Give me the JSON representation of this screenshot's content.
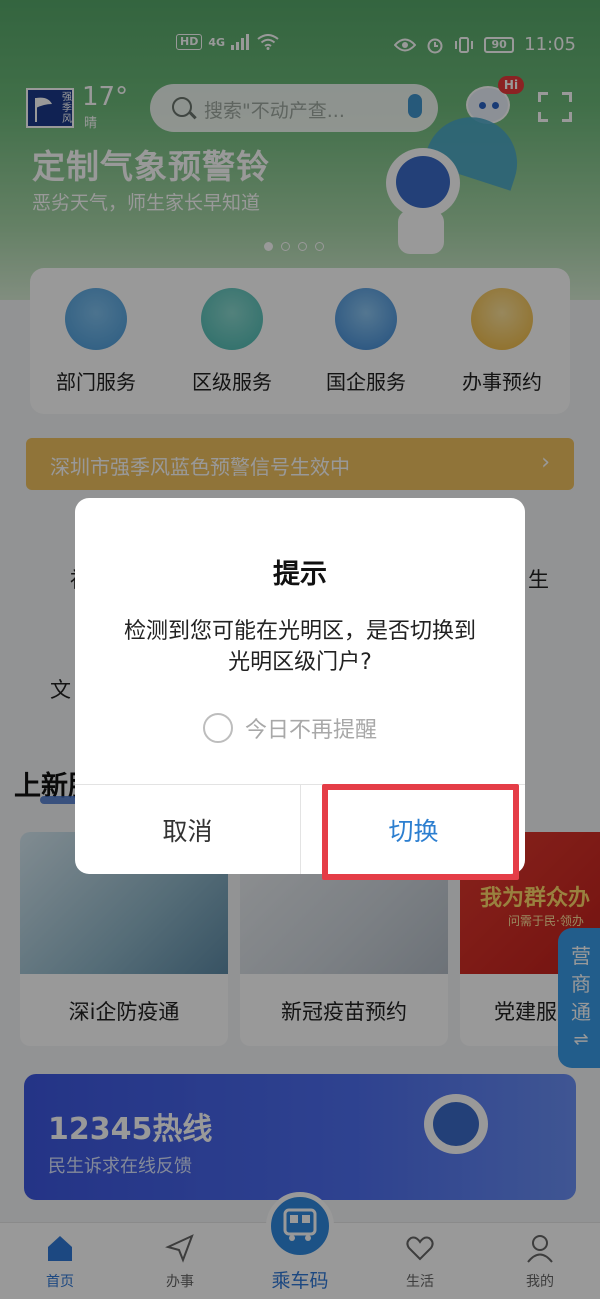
{
  "status_bar": {
    "network_badge": "HD",
    "network_type": "4G",
    "battery": "90",
    "time": "11:05"
  },
  "header": {
    "logo_text": "强季风",
    "temperature": "17°",
    "weather": "晴",
    "search_placeholder": "搜索\"不动产查...",
    "assistant_badge": "Hi"
  },
  "banner": {
    "title": "定制气象预警铃",
    "subtitle": "恶劣天气，师生家长早知道",
    "page_count": 4,
    "active_index": 0
  },
  "services": [
    {
      "label": "部门服务",
      "icon": "department-icon",
      "color": "#4a9ad8"
    },
    {
      "label": "区级服务",
      "icon": "district-icon",
      "color": "#49b8b0"
    },
    {
      "label": "国企服务",
      "icon": "enterprise-icon",
      "color": "#3c86d3"
    },
    {
      "label": "办事预约",
      "icon": "appointment-icon",
      "color": "#f0b63a"
    }
  ],
  "notice": {
    "text": "深圳市强季风蓝色预警信号生效中",
    "arrow": "›"
  },
  "partial_labels": {
    "left_a": "社",
    "left_b": "文",
    "right": "生"
  },
  "section": {
    "title": "上新服"
  },
  "tiles": [
    {
      "label": "深i企防疫通"
    },
    {
      "label": "新冠疫苗预约"
    },
    {
      "label": "党建服",
      "banner_text": "我为群众办",
      "banner_small": "问需于民·领办"
    }
  ],
  "side_tab": {
    "text": "营商通",
    "arrow": "⇌"
  },
  "hotline": {
    "title": "12345热线",
    "subtitle": "民生诉求在线反馈"
  },
  "bottom_nav": {
    "items": [
      {
        "label": "首页",
        "icon": "home-icon",
        "active": true
      },
      {
        "label": "办事",
        "icon": "send-icon",
        "active": false
      },
      {
        "label": "乘车码",
        "icon": "bus-code-icon",
        "active": false
      },
      {
        "label": "生活",
        "icon": "heart-icon",
        "active": false
      },
      {
        "label": "我的",
        "icon": "user-icon",
        "active": false
      }
    ]
  },
  "dialog": {
    "title": "提示",
    "message": "检测到您可能在光明区，是否切换到光明区级门户?",
    "checkbox_label": "今日不再提醒",
    "checkbox_checked": false,
    "cancel_label": "取消",
    "confirm_label": "切换"
  },
  "colors": {
    "accent": "#2d7fd0",
    "highlight": "#e53d47",
    "notice": "#f1c15f"
  }
}
